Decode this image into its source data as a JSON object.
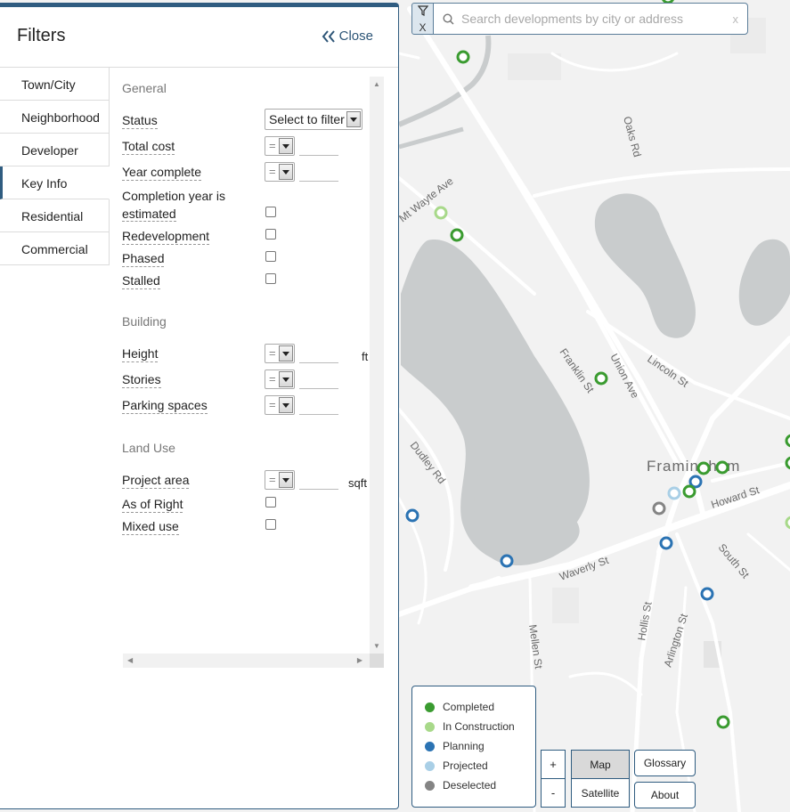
{
  "search": {
    "placeholder": "Search developments by city or address",
    "clear": "x",
    "filter_toggle_x": "X"
  },
  "panel": {
    "title": "Filters",
    "close_label": "Close",
    "tabs": [
      {
        "label": "Town/City"
      },
      {
        "label": "Neighborhood"
      },
      {
        "label": "Developer"
      },
      {
        "label": "Key Info",
        "active": true
      },
      {
        "label": "Residential"
      },
      {
        "label": "Commercial"
      }
    ],
    "sections": {
      "general": "General",
      "building": "Building",
      "land_use": "Land Use"
    },
    "fields": {
      "status": "Status",
      "status_value": "Select to filter",
      "total_cost": "Total cost",
      "year_complete": "Year complete",
      "completion_estimated_1": "Completion year is",
      "completion_estimated_2": "estimated",
      "redevelopment": "Redevelopment",
      "phased": "Phased",
      "stalled": "Stalled",
      "height": "Height",
      "height_unit": "ft",
      "stories": "Stories",
      "parking": "Parking spaces",
      "project_area": "Project area",
      "project_area_unit": "sqft",
      "as_of_right": "As of Right",
      "mixed_use": "Mixed use",
      "operator": "="
    }
  },
  "map": {
    "town": "Framingham",
    "streets": {
      "oaks": "Oaks Rd",
      "mt_wayte": "Mt Wayte Ave",
      "franklin": "Franklin St",
      "union": "Union Ave",
      "lincoln": "Lincoln St",
      "dudley": "Dudley Rd",
      "howard": "Howard St",
      "south": "South St",
      "waverly": "Waverly St",
      "hollis": "Hollis St",
      "arlington": "Arlington St",
      "mellen": "Mellen St"
    }
  },
  "legend": [
    {
      "label": "Completed",
      "color": "#3a9b30"
    },
    {
      "label": "In Construction",
      "color": "#a8d98a"
    },
    {
      "label": "Planning",
      "color": "#2b73b3"
    },
    {
      "label": "Projected",
      "color": "#a9cfe6"
    },
    {
      "label": "Deselected",
      "color": "#848484"
    }
  ],
  "controls": {
    "zoom_in": "+",
    "zoom_out": "-",
    "map": "Map",
    "satellite": "Satellite",
    "glossary": "Glossary",
    "about": "About"
  }
}
